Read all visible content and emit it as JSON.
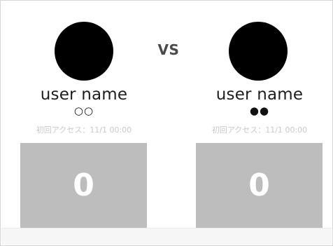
{
  "vs_label": "VS",
  "players": [
    {
      "username": "user name",
      "marks": "○○",
      "access_label": "初回アクセス：11/1 00:00",
      "score": "0"
    },
    {
      "username": "user name",
      "marks": "●●",
      "access_label": "初回アクセス：11/1 00:00",
      "score": "0"
    }
  ],
  "colors": {
    "avatar": "#000000",
    "score_box": "#bdbdbd",
    "score_text": "#ffffff",
    "access_text": "#c9c9c9"
  }
}
